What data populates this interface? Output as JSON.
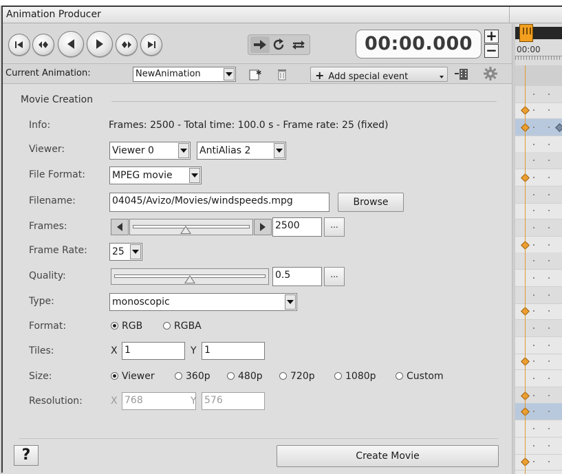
{
  "window": {
    "title": "Animation Producer"
  },
  "transport": {
    "time": "00:00.000",
    "plus_label": "+",
    "minus_label": "−",
    "buttons": [
      "go-to-start",
      "previous-keyframe",
      "play-backward",
      "play-forward",
      "next-keyframe",
      "go-to-end"
    ],
    "modes": [
      "play-once",
      "loop",
      "swing"
    ]
  },
  "animation_row": {
    "label": "Current Animation:",
    "selected": "NewAnimation",
    "add_event_label": "Add special event"
  },
  "movie": {
    "group_title": "Movie Creation",
    "info_label": "Info:",
    "info_value": "Frames: 2500 - Total time: 100.0 s - Frame rate: 25 (fixed)",
    "viewer_label": "Viewer:",
    "viewer_value": "Viewer 0",
    "antialias_value": "AntiAlias 2",
    "file_format_label": "File Format:",
    "file_format_value": "MPEG movie",
    "filename_label": "Filename:",
    "filename_value": "04045/Avizo/Movies/windspeeds.mpg",
    "browse_label": "Browse",
    "frames_label": "Frames:",
    "frames_value": "2500",
    "frames_slider_level": 0.45,
    "ellipsis": "...",
    "frame_rate_label": "Frame Rate:",
    "frame_rate_value": "25",
    "quality_label": "Quality:",
    "quality_value": "0.5",
    "quality_slider_level": 0.5,
    "type_label": "Type:",
    "type_value": "monoscopic",
    "format_label": "Format:",
    "format_options": [
      {
        "label": "RGB",
        "selected": true
      },
      {
        "label": "RGBA",
        "selected": false
      }
    ],
    "tiles_label": "Tiles:",
    "tiles_x_label": "X",
    "tiles_x": "1",
    "tiles_y_label": "Y",
    "tiles_y": "1",
    "size_label": "Size:",
    "size_options": [
      {
        "label": "Viewer",
        "selected": true
      },
      {
        "label": "360p",
        "selected": false
      },
      {
        "label": "480p",
        "selected": false
      },
      {
        "label": "720p",
        "selected": false
      },
      {
        "label": "1080p",
        "selected": false
      },
      {
        "label": "Custom",
        "selected": false
      }
    ],
    "resolution_label": "Resolution:",
    "res_x_label": "X",
    "res_x": "768",
    "res_y_label": "Y",
    "res_y": "576",
    "help_label": "?",
    "create_label": "Create Movie"
  },
  "timeline": {
    "time_label": "00:00",
    "accent_color": "#f0a030"
  }
}
